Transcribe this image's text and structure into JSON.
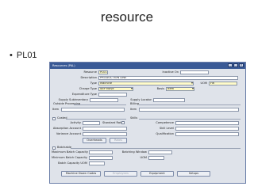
{
  "slide": {
    "title": "resource",
    "bullet": "PL01"
  },
  "window": {
    "title": "Resources (PAL)",
    "fields": {
      "resource": {
        "label": "Resource",
        "value": "PL01"
      },
      "inactive_on": {
        "label": "Inactive On",
        "value": ""
      },
      "description": {
        "label": "Description",
        "value": "PRODUCTION LINE"
      },
      "type": {
        "label": "Type",
        "value": "Machine"
      },
      "uom": {
        "label": "UOM",
        "value": "HR"
      },
      "charge_type": {
        "label": "Charge Type",
        "value": "WIP Move"
      },
      "basis": {
        "label": "Basis",
        "value": "Item"
      },
      "expenditure_type": {
        "label": "Expenditure Type",
        "value": ""
      },
      "supply_subinventory": {
        "label": "Supply Subinventory",
        "value": ""
      },
      "supply_locator": {
        "label": "Supply Locator",
        "value": ""
      },
      "outside_processing": {
        "label": "Outside Processing",
        "value": ""
      },
      "billing": {
        "label": "Billing",
        "value": ""
      },
      "op_item": {
        "label": "Item",
        "value": ""
      },
      "billing_item": {
        "label": "Item",
        "value": ""
      },
      "costed": {
        "label": "Costed",
        "value": ""
      },
      "activity": {
        "label": "Activity",
        "value": ""
      },
      "standard_rate": {
        "label": "Standard Rate",
        "value": ""
      },
      "absorption_account": {
        "label": "Absorption Account",
        "value": ""
      },
      "variance_account": {
        "label": "Variance Account",
        "value": ""
      },
      "skills": {
        "label": "Skills",
        "value": ""
      },
      "competence": {
        "label": "Competence",
        "value": ""
      },
      "skill_level": {
        "label": "Skill Level",
        "value": ""
      },
      "qualification": {
        "label": "Qualification",
        "value": ""
      },
      "batchable": {
        "label": "Batchable",
        "value": ""
      },
      "max_batch_capacity": {
        "label": "Maximum Batch Capacity",
        "value": ""
      },
      "min_batch_capacity": {
        "label": "Minimum Batch Capacity",
        "value": ""
      },
      "batch_capacity_uom": {
        "label": "Batch Capacity UOM",
        "value": ""
      },
      "batching_window": {
        "label": "Batching Window",
        "value": ""
      },
      "batch_uom": {
        "label": "UOM",
        "value": ""
      }
    },
    "buttons": {
      "overheads": "Overheads",
      "rates": "Rates",
      "machine_down_codes": "Machine Down Codes",
      "employees": "Employees",
      "equipment": "Equipment",
      "setups": "Setups"
    },
    "colors": {
      "titlebar": "#3a5a96",
      "required": "#fffbc8",
      "window_bg": "#dfe3ea"
    }
  }
}
